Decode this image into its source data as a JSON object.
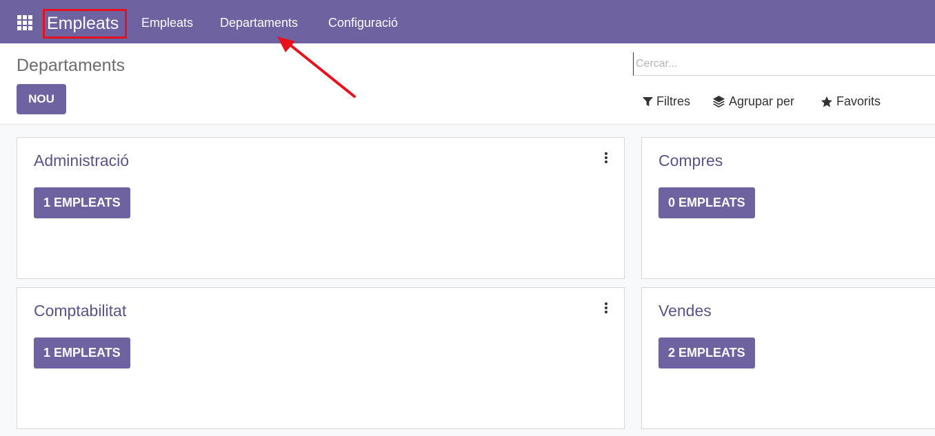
{
  "navbar": {
    "brand": "Empleats",
    "items": [
      "Empleats",
      "Departaments",
      "Configuració"
    ]
  },
  "control": {
    "title": "Departaments",
    "new_button": "NOU",
    "search_placeholder": "Cercar...",
    "filters": "Filtres",
    "group_by": "Agrupar per",
    "favorites": "Favorits"
  },
  "cards": [
    {
      "title": "Administració",
      "employees": "1 EMPLEATS"
    },
    {
      "title": "Compres",
      "employees": "0 EMPLEATS"
    },
    {
      "title": "Comptabilitat",
      "employees": "1 EMPLEATS"
    },
    {
      "title": "Vendes",
      "employees": "2 EMPLEATS"
    }
  ],
  "colors": {
    "brand": "#6e62a0",
    "annotation": "#e8101b"
  }
}
